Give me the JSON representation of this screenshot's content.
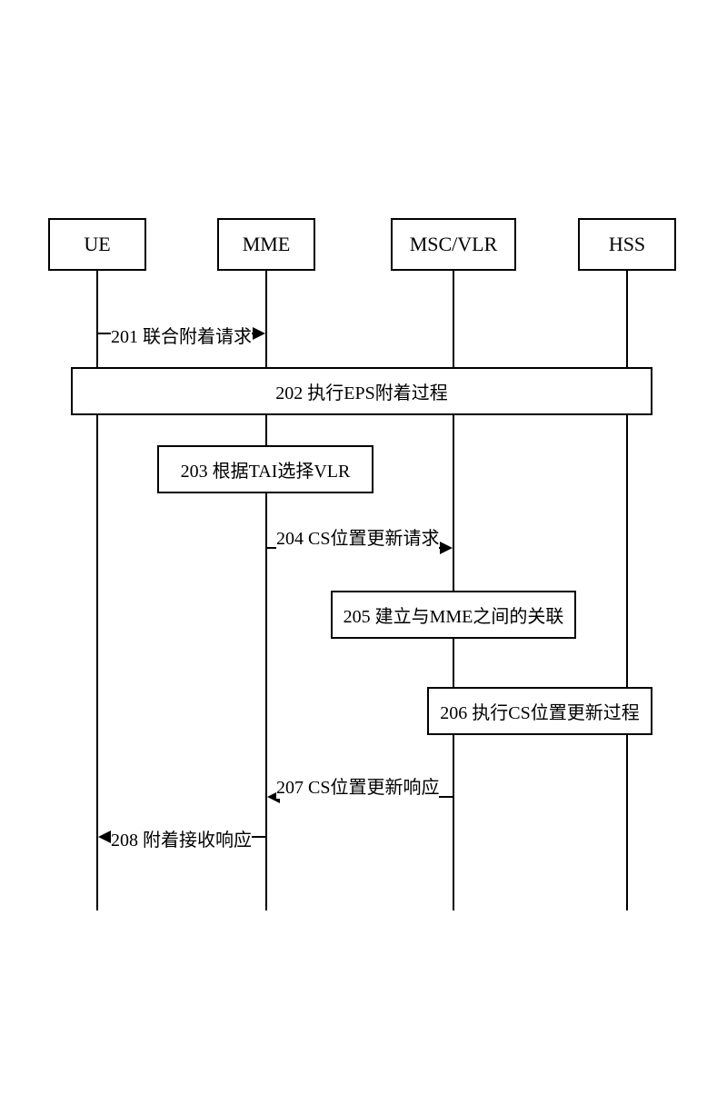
{
  "actors": {
    "ue": "UE",
    "mme": "MME",
    "msc": "MSC/VLR",
    "hss": "HSS"
  },
  "messages": {
    "m201": "201 联合附着请求",
    "m202": "202 执行EPS附着过程",
    "m203": "203 根据TAI选择VLR",
    "m204": "204 CS位置更新请求",
    "m205": "205 建立与MME之间的关联",
    "m206": "206 执行CS位置更新过程",
    "m207": "207 CS位置更新响应",
    "m208": "208 附着接收响应"
  }
}
